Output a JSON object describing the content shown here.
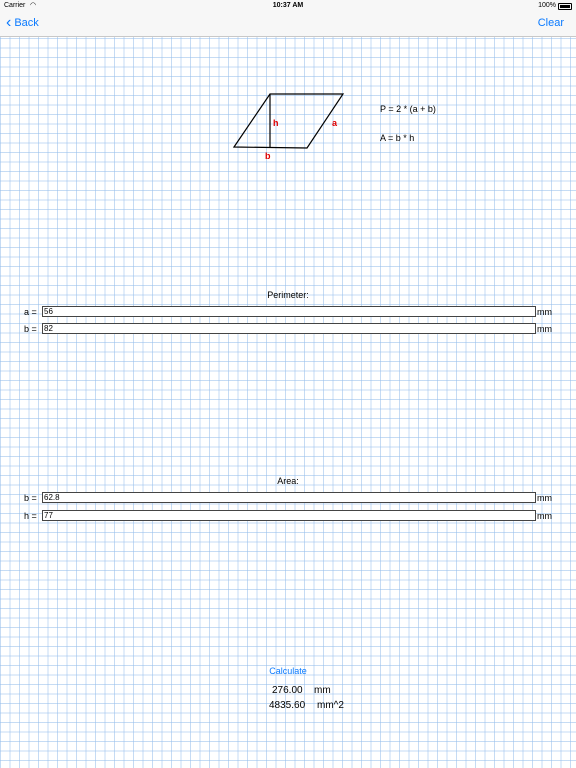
{
  "status": {
    "carrier": "Carrier",
    "time": "10:37 AM",
    "battery": "100%"
  },
  "nav": {
    "back_label": "Back",
    "clear_label": "Clear"
  },
  "diagram": {
    "label_h": "h",
    "label_a": "a",
    "label_b": "b"
  },
  "formulas": {
    "perimeter": "P = 2 * (a + b)",
    "area": "A = b * h"
  },
  "perimeter": {
    "title": "Perimeter:",
    "a": {
      "label": "a =",
      "value": "56",
      "unit": "mm"
    },
    "b": {
      "label": "b =",
      "value": "82",
      "unit": "mm"
    }
  },
  "area": {
    "title": "Area:",
    "b": {
      "label": "b =",
      "value": "62.8",
      "unit": "mm"
    },
    "h": {
      "label": "h =",
      "value": "77",
      "unit": "mm"
    }
  },
  "calculate_label": "Calculate",
  "results": {
    "perimeter": {
      "value": "276.00",
      "unit": "mm"
    },
    "area": {
      "value": "4835.60",
      "unit": "mm^2"
    }
  },
  "colors": {
    "accent": "#0a7aff",
    "diagram_label": "#e00000"
  }
}
